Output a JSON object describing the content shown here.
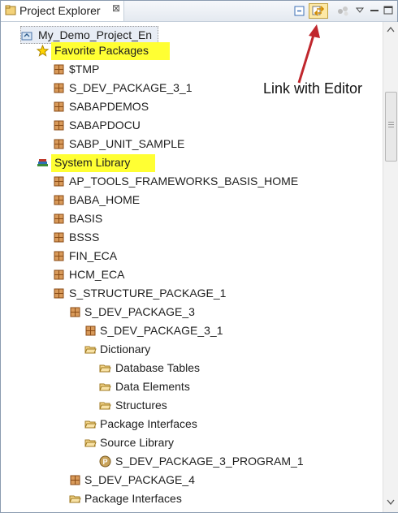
{
  "tab": {
    "title": "Project Explorer",
    "close": "⊠"
  },
  "toolbar": {
    "collapse_icon": "collapse-all-icon",
    "link_icon": "link-with-editor-icon",
    "menu_icon": "view-menu-icon"
  },
  "annotation": {
    "text": "Link with Editor"
  },
  "tree": {
    "project": "My_Demo_Project_En",
    "favorites": "Favorite Packages",
    "fav_items": [
      "$TMP",
      "S_DEV_PACKAGE_3_1",
      "SABAPDEMOS",
      "SABAPDOCU",
      "SABP_UNIT_SAMPLE"
    ],
    "syslib": "System Library",
    "sys_items": [
      "AP_TOOLS_FRAMEWORKS_BASIS_HOME",
      "BABA_HOME",
      "BASIS",
      "BSSS",
      "FIN_ECA",
      "HCM_ECA",
      "S_STRUCTURE_PACKAGE_1"
    ],
    "struct": {
      "dev3": "S_DEV_PACKAGE_3",
      "dev31": "S_DEV_PACKAGE_3_1",
      "dictionary": "Dictionary",
      "db_tables": "Database Tables",
      "data_elements": "Data Elements",
      "structures": "Structures",
      "pkg_if_1": "Package Interfaces",
      "source_lib": "Source Library",
      "program": "S_DEV_PACKAGE_3_PROGRAM_1",
      "dev4": "S_DEV_PACKAGE_4",
      "pkg_if_2": "Package Interfaces"
    }
  },
  "colors": {
    "highlight": "#ffff33",
    "arrow": "#c0272d",
    "package": "#b5651d",
    "folder": "#e8b84a"
  }
}
